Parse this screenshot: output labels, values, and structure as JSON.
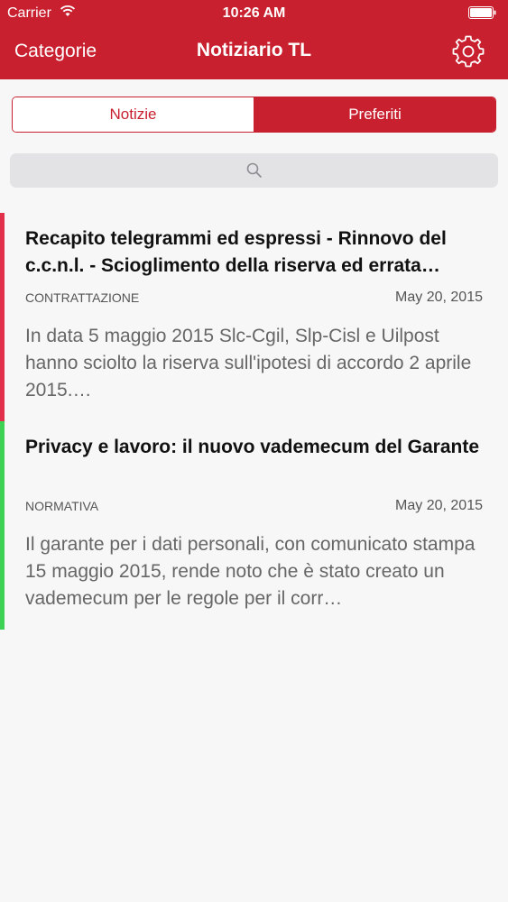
{
  "status_bar": {
    "carrier": "Carrier",
    "time": "10:26 AM"
  },
  "nav": {
    "left_label": "Categorie",
    "title": "Notiziario TL",
    "right_icon": "gear-icon"
  },
  "tabs": [
    {
      "label": "Notizie",
      "selected": false
    },
    {
      "label": "Preferiti",
      "selected": true
    }
  ],
  "search": {
    "icon": "search-icon"
  },
  "items": [
    {
      "title": "Recapito telegrammi ed espressi - Rinnovo del c.c.n.l. - Scioglimento della riserva ed errata…",
      "category": "CONTRATTAZIONE",
      "date": "May 20, 2015",
      "summary": "In data 5 maggio 2015 Slc-Cgil, Slp-Cisl e Uilpost hanno sciolto la riserva sull'ipotesi di accordo 2 aprile 2015.…",
      "accent_color": "#e2304a"
    },
    {
      "title": "Privacy e lavoro: il nuovo vademecum del Garante",
      "category": "NORMATIVA",
      "date": "May 20, 2015",
      "summary": "Il garante per i dati personali, con comunicato stampa 15 maggio 2015, rende noto che è stato creato un vademecum per le regole per il corr…",
      "accent_color": "#3ed255"
    }
  ],
  "colors": {
    "brand": "#c8202f",
    "background": "#f7f7f7"
  }
}
